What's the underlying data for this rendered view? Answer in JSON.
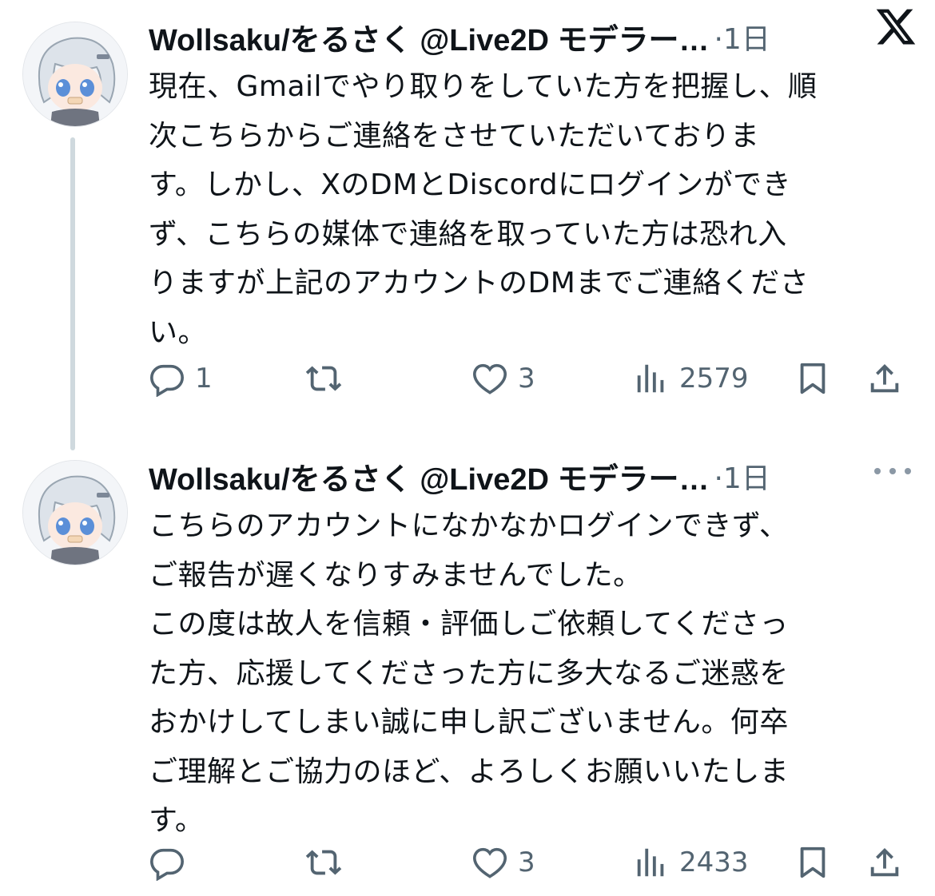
{
  "tweets": [
    {
      "author_name": "Wollsaku/をるさく",
      "handle": "@Live2D モデラー…",
      "time": "·1日",
      "text": "現在、Gmailでやり取りをしていた方を把握し、順\n次こちらからご連絡をさせていただいておりま\nす。しかし、XのDMとDiscordにログインができ\nず、こちらの媒体で連絡を取っていた方は恐れ入\nりますが上記のアカウントのDMまでご連絡くださ\nい。",
      "stats": {
        "replies": "1",
        "retweets": "",
        "likes": "3",
        "views": "2579"
      }
    },
    {
      "author_name": "Wollsaku/をるさく",
      "handle": "@Live2D モデラー…",
      "time": "·1日",
      "text": "こちらのアカウントになかなかログインできず、\nご報告が遅くなりすみませんでした。\nこの度は故人を信頼・評価しご依頼してくださっ\nた方、応援してくださった方に多大なるご迷惑を\nおかけしてしまい誠に申し訳ございません。何卒\nご理解とご協力のほど、よろしくお願いいたしま\nす。",
      "stats": {
        "replies": "",
        "retweets": "",
        "likes": "3",
        "views": "2433"
      }
    }
  ],
  "icons": {
    "brand": "x-logo-icon",
    "reply": "reply-icon",
    "retweet": "retweet-icon",
    "like": "heart-icon",
    "views": "views-icon",
    "bookmark": "bookmark-icon",
    "share": "share-icon",
    "more": "more-icon"
  },
  "colors": {
    "text": "#0f1419",
    "secondary": "#536471",
    "thread_line": "#cfd9de",
    "background": "#ffffff"
  }
}
